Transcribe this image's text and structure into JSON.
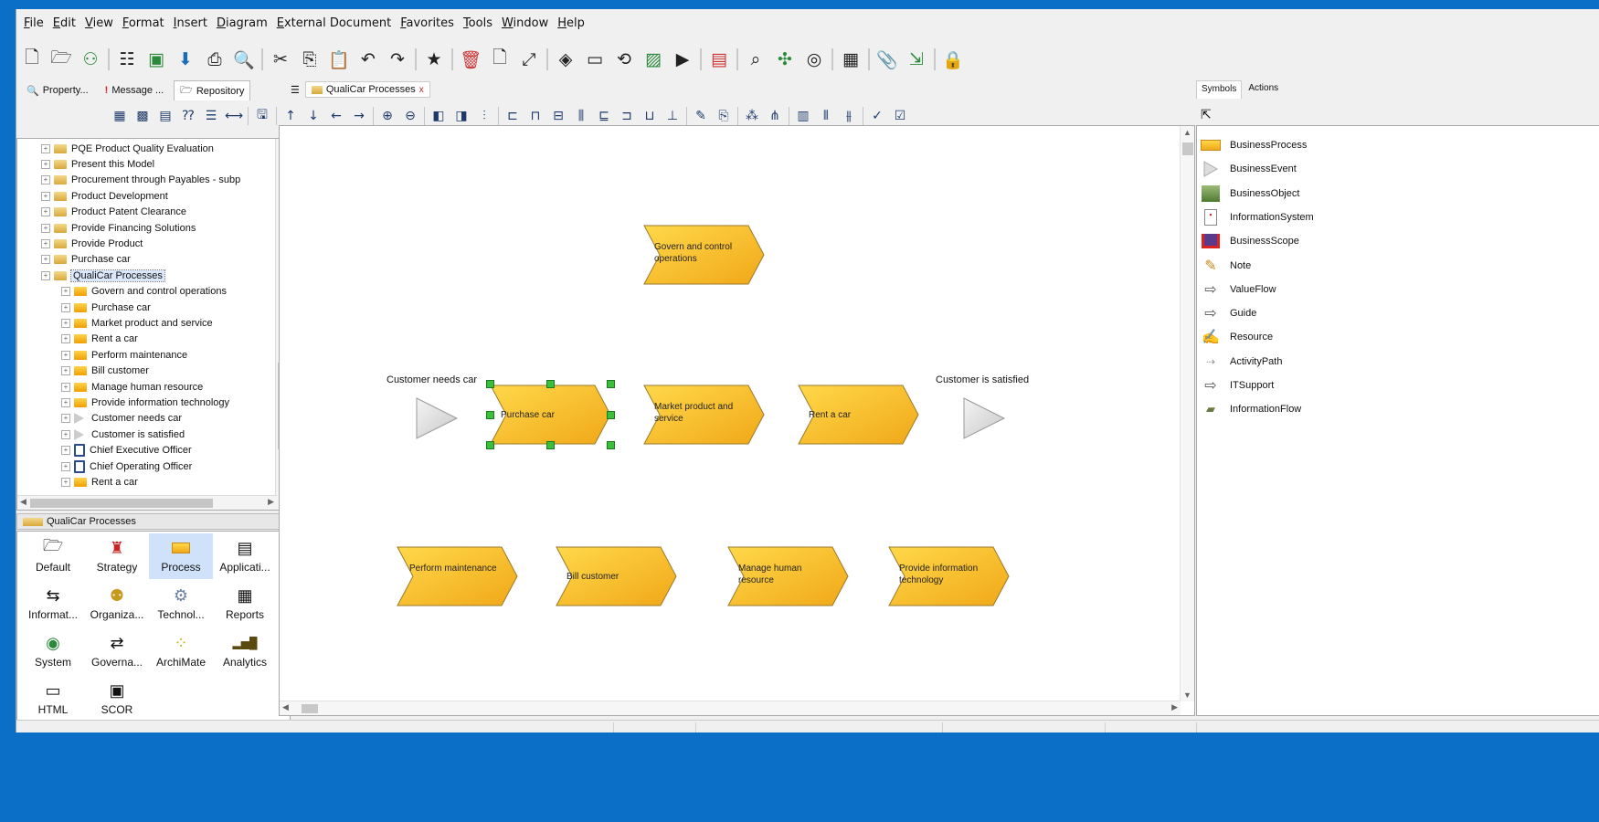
{
  "menu": [
    "File",
    "Edit",
    "View",
    "Format",
    "Insert",
    "Diagram",
    "External Document",
    "Favorites",
    "Tools",
    "Window",
    "Help"
  ],
  "left_tabs": [
    {
      "label": "Property...",
      "icon": "property-icon"
    },
    {
      "label": "Message ...",
      "icon": "message-icon"
    },
    {
      "label": "Repository",
      "icon": "repository-icon"
    }
  ],
  "editor_tab": {
    "label": "QualiCar Processes",
    "close": "x"
  },
  "tree": [
    {
      "label": "PQE Product Quality Evaluation",
      "type": "model",
      "indent": 0
    },
    {
      "label": "Present this Model",
      "type": "model",
      "indent": 0
    },
    {
      "label": "Procurement through Payables - subp",
      "type": "model",
      "indent": 0
    },
    {
      "label": "Product Development",
      "type": "model",
      "indent": 0
    },
    {
      "label": "Product Patent Clearance",
      "type": "model",
      "indent": 0
    },
    {
      "label": "Provide Financing Solutions",
      "type": "model",
      "indent": 0
    },
    {
      "label": "Provide Product",
      "type": "model",
      "indent": 0
    },
    {
      "label": "Purchase car",
      "type": "model",
      "indent": 0
    },
    {
      "label": "QualiCar Processes",
      "type": "model",
      "indent": 0,
      "selected": true
    },
    {
      "label": "Govern and control operations",
      "type": "process",
      "indent": 1
    },
    {
      "label": "Purchase car",
      "type": "process",
      "indent": 1
    },
    {
      "label": "Market product and service",
      "type": "process",
      "indent": 1
    },
    {
      "label": "Rent a car",
      "type": "process",
      "indent": 1
    },
    {
      "label": "Perform maintenance",
      "type": "process",
      "indent": 1
    },
    {
      "label": "Bill customer",
      "type": "process",
      "indent": 1
    },
    {
      "label": "Manage human resource",
      "type": "process",
      "indent": 1
    },
    {
      "label": "Provide information technology",
      "type": "process",
      "indent": 1
    },
    {
      "label": "Customer needs car",
      "type": "event",
      "indent": 1
    },
    {
      "label": "Customer is satisfied",
      "type": "event",
      "indent": 1
    },
    {
      "label": "Chief Executive Officer",
      "type": "person",
      "indent": 1
    },
    {
      "label": "Chief Operating Officer",
      "type": "person",
      "indent": 1
    },
    {
      "label": "Rent a car",
      "type": "process",
      "indent": 1
    }
  ],
  "model_bar": {
    "label": "QualiCar Processes"
  },
  "palette": [
    {
      "label": "Default",
      "icon": "folder-icon"
    },
    {
      "label": "Strategy",
      "icon": "strategy-icon"
    },
    {
      "label": "Process",
      "icon": "process-icon",
      "active": true
    },
    {
      "label": "Applicati...",
      "icon": "application-icon"
    },
    {
      "label": "Informat...",
      "icon": "information-icon"
    },
    {
      "label": "Organiza...",
      "icon": "organization-icon"
    },
    {
      "label": "Technol...",
      "icon": "technology-icon"
    },
    {
      "label": "Reports",
      "icon": "reports-icon"
    },
    {
      "label": "System",
      "icon": "system-icon"
    },
    {
      "label": "Governa...",
      "icon": "governance-icon"
    },
    {
      "label": "ArchiMate",
      "icon": "archimate-icon"
    },
    {
      "label": "Analytics",
      "icon": "analytics-icon"
    },
    {
      "label": "HTML",
      "icon": "html-icon"
    },
    {
      "label": "SCOR",
      "icon": "scor-icon"
    }
  ],
  "diagram": {
    "processes": [
      {
        "label": "Govern and control operations",
        "selected": false
      },
      {
        "label": "Purchase car",
        "selected": true
      },
      {
        "label": "Market product and service",
        "selected": false
      },
      {
        "label": "Rent a car",
        "selected": false
      },
      {
        "label": "Perform maintenance",
        "selected": false
      },
      {
        "label": "Bill customer",
        "selected": false
      },
      {
        "label": "Manage human resource",
        "selected": false
      },
      {
        "label": "Provide information technology",
        "selected": false
      }
    ],
    "events": [
      {
        "label": "Customer needs car"
      },
      {
        "label": "Customer is satisfied"
      }
    ]
  },
  "right_tabs": [
    "Symbols",
    "Actions"
  ],
  "symbols": [
    {
      "label": "BusinessProcess",
      "icon": "business-process-icon"
    },
    {
      "label": "BusinessEvent",
      "icon": "business-event-icon"
    },
    {
      "label": "BusinessObject",
      "icon": "business-object-icon"
    },
    {
      "label": "InformationSystem",
      "icon": "information-system-icon"
    },
    {
      "label": "BusinessScope",
      "icon": "business-scope-icon"
    },
    {
      "label": "Note",
      "icon": "note-icon"
    },
    {
      "label": "ValueFlow",
      "icon": "value-flow-icon"
    },
    {
      "label": "Guide",
      "icon": "guide-icon"
    },
    {
      "label": "Resource",
      "icon": "resource-icon"
    },
    {
      "label": "ActivityPath",
      "icon": "activity-path-icon"
    },
    {
      "label": "ITSupport",
      "icon": "it-support-icon"
    },
    {
      "label": "InformationFlow",
      "icon": "information-flow-icon"
    }
  ],
  "colors": {
    "process_top": "#ffd84a",
    "process_bottom": "#f0a818",
    "accent_blue": "#0b6fc7",
    "handle": "#3bbf3b"
  }
}
